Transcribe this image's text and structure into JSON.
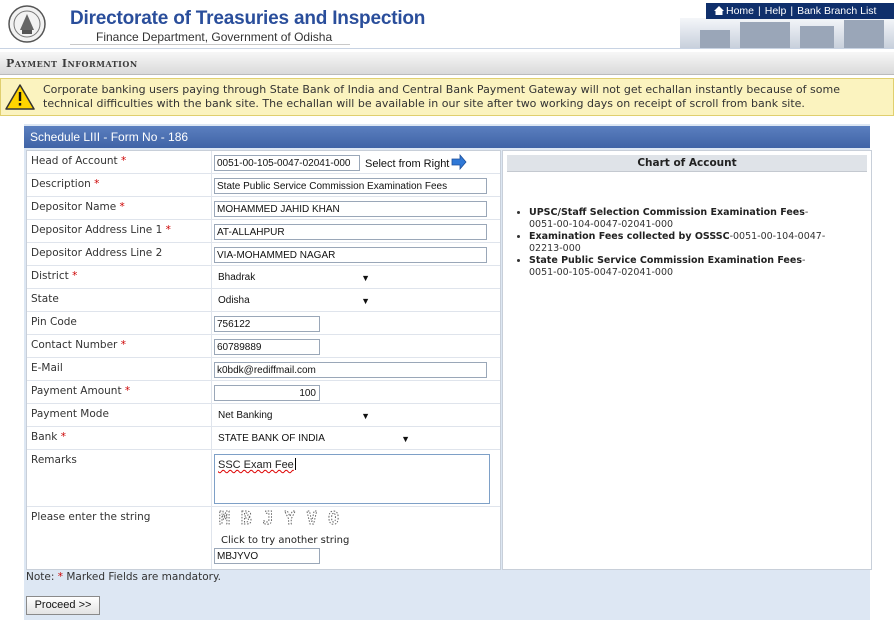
{
  "header": {
    "title": "Directorate of Treasuries and Inspection",
    "subtitle": "Finance Department, Government of Odisha",
    "nav": {
      "home": "Home",
      "help": "Help",
      "bank_branch_list": "Bank Branch List",
      "separator": "|"
    }
  },
  "section": {
    "title": "Payment Information"
  },
  "notice": {
    "text": "Corporate banking users paying through State Bank of India and Central Bank Payment Gateway will not get echallan instantly because of some technical difficulties with the bank site. The echallan will be available in our site after two working days on receipt of scroll from bank site."
  },
  "form": {
    "heading": "Schedule LIII - Form No - 186",
    "select_from_right": "Select from Right",
    "fields": {
      "head_of_account": {
        "label": "Head of Account",
        "value": "0051-00-105-0047-02041-000"
      },
      "description": {
        "label": "Description",
        "value": "State Public Service Commission Examination Fees"
      },
      "depositor_name": {
        "label": "Depositor Name",
        "value": "MOHAMMED JAHID KHAN"
      },
      "address1": {
        "label": "Depositor Address Line 1",
        "value": "AT-ALLAHPUR"
      },
      "address2": {
        "label": "Depositor Address Line 2",
        "value": "VIA-MOHAMMED NAGAR"
      },
      "district": {
        "label": "District",
        "value": "Bhadrak"
      },
      "state": {
        "label": "State",
        "value": "Odisha"
      },
      "pin_code": {
        "label": "Pin Code",
        "value": "756122"
      },
      "contact_number": {
        "label": "Contact Number",
        "value": "60789889"
      },
      "email": {
        "label": "E-Mail",
        "value": "k0bdk@rediffmail.com"
      },
      "payment_amount": {
        "label": "Payment Amount",
        "value": "100"
      },
      "payment_mode": {
        "label": "Payment Mode",
        "value": "Net Banking"
      },
      "bank": {
        "label": "Bank",
        "value": "STATE BANK OF INDIA"
      },
      "remarks": {
        "label": "Remarks",
        "value": "SSC Exam Fee"
      },
      "captcha": {
        "label": "Please enter the string",
        "image_text": "MBJYVO",
        "refresh": "Click to try another string",
        "value": "MBJYVO"
      }
    },
    "required_marker": "*",
    "note_prefix": "Note:",
    "note_suffix": "Marked Fields are mandatory.",
    "proceed": "Proceed >>"
  },
  "chart_of_account": {
    "title": "Chart of Account",
    "items": [
      {
        "name": "UPSC/Staff Selection Commission Examination Fees",
        "code": "-0051-00-104-0047-02041-000"
      },
      {
        "name": "Examination Fees collected by OSSSC",
        "code": "-0051-00-104-0047-02213-000"
      },
      {
        "name": "State Public Service Commission Examination Fees",
        "code": "-0051-00-105-0047-02041-000"
      }
    ]
  },
  "colors": {
    "brand_blue": "#2a4e9b",
    "nav_bg": "#0f2f6b",
    "form_header": "#4a6fb3",
    "notice_bg": "#fbf3bf",
    "required": "#cc0000"
  }
}
